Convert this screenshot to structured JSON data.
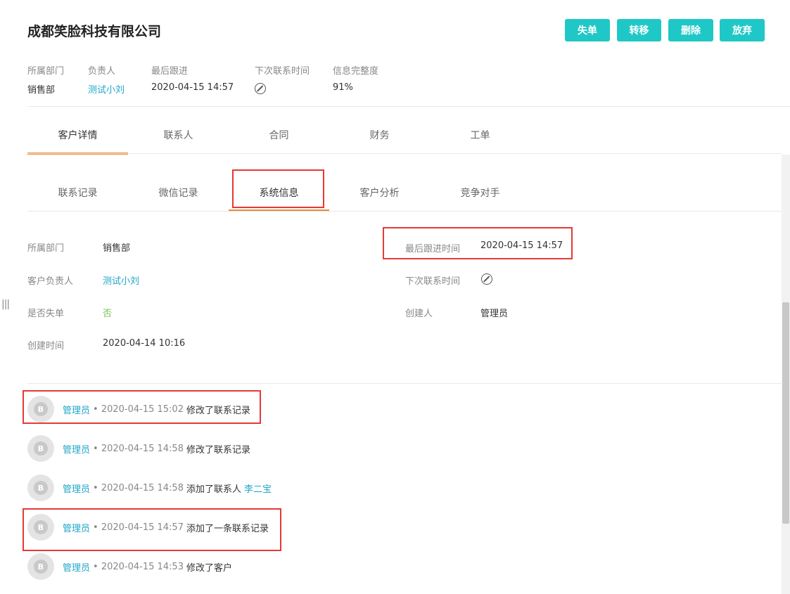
{
  "header": {
    "company_name": "成都笑脸科技有限公司",
    "buttons": [
      "失单",
      "转移",
      "删除",
      "放弃"
    ]
  },
  "meta": {
    "department_label": "所属部门",
    "department_value": "销售部",
    "owner_label": "负责人",
    "owner_value": "测试小刘",
    "last_follow_label": "最后跟进",
    "last_follow_value": "2020-04-15 14:57",
    "next_contact_label": "下次联系时间",
    "completeness_label": "信息完整度",
    "completeness_value": "91%"
  },
  "main_tabs": [
    "客户详情",
    "联系人",
    "合同",
    "财务",
    "工单"
  ],
  "sub_tabs": [
    "联系记录",
    "微信记录",
    "系统信息",
    "客户分析",
    "竞争对手"
  ],
  "system_info": {
    "department_label": "所属部门",
    "department_value": "销售部",
    "owner_label": "客户负责人",
    "owner_value": "测试小刘",
    "lost_label": "是否失单",
    "lost_value": "否",
    "created_label": "创建时间",
    "created_value": "2020-04-14 10:16",
    "last_follow_label": "最后跟进时间",
    "last_follow_value": "2020-04-15 14:57",
    "next_contact_label": "下次联系时间",
    "creator_label": "创建人",
    "creator_value": "管理员"
  },
  "activities": [
    {
      "user": "管理员",
      "time": "• 2020-04-15 15:02",
      "text": "修改了联系记录",
      "link": ""
    },
    {
      "user": "管理员",
      "time": "• 2020-04-15 14:58",
      "text": "修改了联系记录",
      "link": ""
    },
    {
      "user": "管理员",
      "time": "• 2020-04-15 14:58",
      "text": "添加了联系人",
      "link": "李二宝"
    },
    {
      "user": "管理员",
      "time": "• 2020-04-15 14:57",
      "text": "添加了一条联系记录",
      "link": ""
    },
    {
      "user": "管理员",
      "time": "• 2020-04-15 14:53",
      "text": "修改了客户",
      "link": ""
    }
  ],
  "avatar_glyph": "B",
  "icons": {
    "no_value_icon": "prohibited-circle",
    "resize_handle": "|||"
  },
  "colors": {
    "accent": "#1fc8c6",
    "link": "#1fa6c8",
    "tab_active_underline": "#f28a30",
    "highlight_box": "#e53935",
    "positive": "#7bc35a"
  }
}
